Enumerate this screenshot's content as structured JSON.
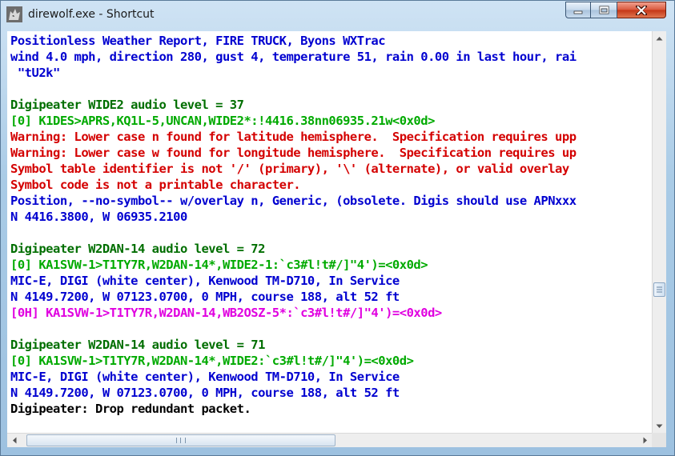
{
  "window": {
    "title": "direwolf.exe - Shortcut",
    "icon": "wolf-app-icon",
    "controls": [
      "minimize-icon",
      "maximize-icon",
      "close-icon"
    ]
  },
  "colors": {
    "blue": "#0000d0",
    "green": "#00aa00",
    "dark_green": "#006e00",
    "red": "#d40000",
    "magenta": "#e000e0",
    "black": "#000000"
  },
  "console": {
    "lines": [
      {
        "text": "Positionless Weather Report, FIRE TRUCK, Byons WXTrac",
        "color": "blue"
      },
      {
        "text": "wind 4.0 mph, direction 280, gust 4, temperature 51, rain 0.00 in last hour, rai",
        "color": "blue"
      },
      {
        "text": " \"tU2k\"",
        "color": "blue"
      },
      {
        "text": "",
        "color": "black"
      },
      {
        "text": "Digipeater WIDE2 audio level = 37",
        "color": "dark_green"
      },
      {
        "text": "[0] K1DES>APRS,KQ1L-5,UNCAN,WIDE2*:!4416.38nn06935.21w<0x0d>",
        "color": "green"
      },
      {
        "text": "Warning: Lower case n found for latitude hemisphere.  Specification requires upp",
        "color": "red"
      },
      {
        "text": "Warning: Lower case w found for longitude hemisphere.  Specification requires up",
        "color": "red"
      },
      {
        "text": "Symbol table identifier is not '/' (primary), '\\' (alternate), or valid overlay",
        "color": "red"
      },
      {
        "text": "Symbol code is not a printable character.",
        "color": "red"
      },
      {
        "text": "Position, --no-symbol-- w/overlay n, Generic, (obsolete. Digis should use APNxxx",
        "color": "blue"
      },
      {
        "text": "N 4416.3800, W 06935.2100",
        "color": "blue"
      },
      {
        "text": "",
        "color": "black"
      },
      {
        "text": "Digipeater W2DAN-14 audio level = 72",
        "color": "dark_green"
      },
      {
        "text": "[0] KA1SVW-1>T1TY7R,W2DAN-14*,WIDE2-1:`c3#l!t#/]\"4')=<0x0d>",
        "color": "green"
      },
      {
        "text": "MIC-E, DIGI (white center), Kenwood TM-D710, In Service",
        "color": "blue"
      },
      {
        "text": "N 4149.7200, W 07123.0700, 0 MPH, course 188, alt 52 ft",
        "color": "blue"
      },
      {
        "text": "[0H] KA1SVW-1>T1TY7R,W2DAN-14,WB2OSZ-5*:`c3#l!t#/]\"4')=<0x0d>",
        "color": "magenta"
      },
      {
        "text": "",
        "color": "black"
      },
      {
        "text": "Digipeater W2DAN-14 audio level = 71",
        "color": "dark_green"
      },
      {
        "text": "[0] KA1SVW-1>T1TY7R,W2DAN-14*,WIDE2:`c3#l!t#/]\"4')=<0x0d>",
        "color": "green"
      },
      {
        "text": "MIC-E, DIGI (white center), Kenwood TM-D710, In Service",
        "color": "blue"
      },
      {
        "text": "N 4149.7200, W 07123.0700, 0 MPH, course 188, alt 52 ft",
        "color": "blue"
      },
      {
        "text": "Digipeater: Drop redundant packet.",
        "color": "black"
      }
    ]
  },
  "scrollbars": {
    "vertical_position": 0.66,
    "horizontal_position": 0.0
  }
}
